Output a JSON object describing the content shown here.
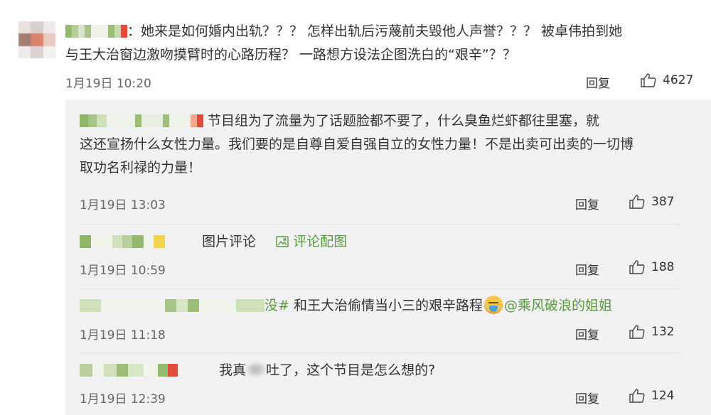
{
  "main_comment": {
    "text_line1": "：她来是如何婚内出轨？？？ 怎样出轨后污蔑前夫毁他人声誉？？？ 被卓伟拍到她",
    "text_line2": "与王大治窗边激吻摸臂时的心路历程？ 一路想方设法企图洗白的“艰辛”？？",
    "time": "1月19日 10:20",
    "reply_label": "回复",
    "likes": "4627"
  },
  "replies": [
    {
      "line1": "节目组为了流量为了话题脸都不要了，什么臭鱼烂虾都往里塞，就",
      "line2": "这还宣扬什么女性力量。我们要的是自尊自爱自强自立的女性力量！不是出卖可出卖的一切博",
      "line3": "取功名利禄的力量！",
      "time": "1月19日 13:03",
      "reply_label": "回复",
      "likes": "387"
    },
    {
      "text": "图片评论",
      "link": "评论配图",
      "time": "1月19日 10:59",
      "reply_label": "回复",
      "likes": "188"
    },
    {
      "hashtag_tail": "没#",
      "text": " 和王大治偷情当小三的艰辛路程",
      "mention": "@乘风破浪的姐姐",
      "time": "1月19日 11:18",
      "reply_label": "回复",
      "likes": "132"
    },
    {
      "text_before": "我真",
      "text_after": "吐了，这个节目是怎么想的?",
      "time": "1月19日 12:39",
      "reply_label": "回复",
      "likes": "124"
    }
  ],
  "colors": {
    "link_green": "#5a9a3c",
    "reply_bg": "#f2f2f5",
    "meta_gray": "#666666"
  }
}
